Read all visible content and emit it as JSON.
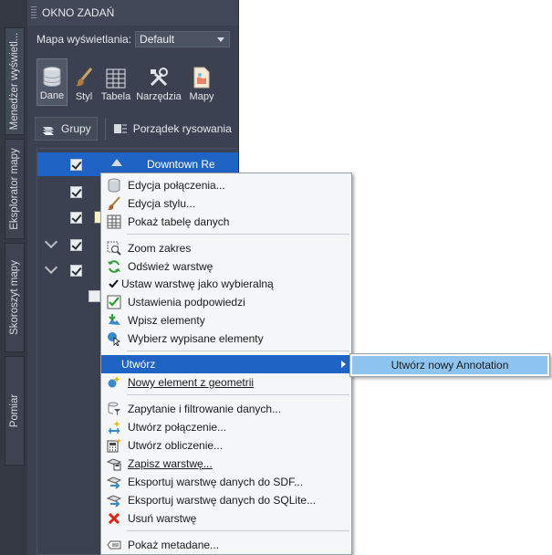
{
  "palette": {
    "title": "OKNO ZADAŃ",
    "map_label": "Mapa wyświetlania:",
    "map_value": "Default",
    "tools": [
      {
        "label": "Dane",
        "icon": "database-icon"
      },
      {
        "label": "Styl",
        "icon": "brush-icon"
      },
      {
        "label": "Tabela",
        "icon": "table-icon"
      },
      {
        "label": "Narzędzia",
        "icon": "tools-icon"
      },
      {
        "label": "Mapy",
        "icon": "maps-icon"
      }
    ],
    "groups_label": "Grupy",
    "draw_order_label": "Porządek rysowania",
    "tree_selected_label": "Downtown Re"
  },
  "vtabs": [
    {
      "label": "Menedżer wyświetl..."
    },
    {
      "label": "Eksplorator mapy"
    },
    {
      "label": "Skoroszyt mapy"
    },
    {
      "label": "Pomiar"
    }
  ],
  "menu": {
    "items": [
      {
        "label": "Edycja połączenia...",
        "icon": "database-icon"
      },
      {
        "label": "Edycja stylu...",
        "icon": "brush-icon"
      },
      {
        "label": "Pokaż tabelę danych",
        "icon": "table-icon"
      },
      {
        "label": "Zoom zakres",
        "icon": "zoom-extent-icon"
      },
      {
        "label": "Odśwież warstwę",
        "icon": "refresh-icon"
      },
      {
        "label": "Ustaw warstwę jako wybieralną",
        "icon": "check-icon"
      },
      {
        "label": "Ustawienia podpowiedzi",
        "icon": "tooltip-settings-icon"
      },
      {
        "label": "Wpisz elementy",
        "icon": "checkin-icon"
      },
      {
        "label": "Wybierz wypisane elementy",
        "icon": "select-checked-out-icon"
      },
      {
        "label": "Utwórz",
        "icon": ""
      },
      {
        "label": "Nowy element z geometrii",
        "icon": "new-feature-icon"
      },
      {
        "label": "Zapytanie i filtrowanie danych...",
        "icon": "query-filter-icon"
      },
      {
        "label": "Utwórz połączenie...",
        "icon": "join-icon"
      },
      {
        "label": "Utwórz obliczenie...",
        "icon": "calculator-icon"
      },
      {
        "label": "Zapisz warstwę...",
        "icon": "save-layer-icon"
      },
      {
        "label": "Eksportuj warstwę danych do SDF...",
        "icon": "export-sdf-icon"
      },
      {
        "label": "Eksportuj warstwę danych do SQLite...",
        "icon": "export-sqlite-icon"
      },
      {
        "label": "Usuń warstwę",
        "icon": "delete-icon"
      },
      {
        "label": "Pokaż metadane...",
        "icon": "metadata-icon"
      }
    ]
  },
  "submenu": {
    "label": "Utwórz nowy Annotation"
  }
}
